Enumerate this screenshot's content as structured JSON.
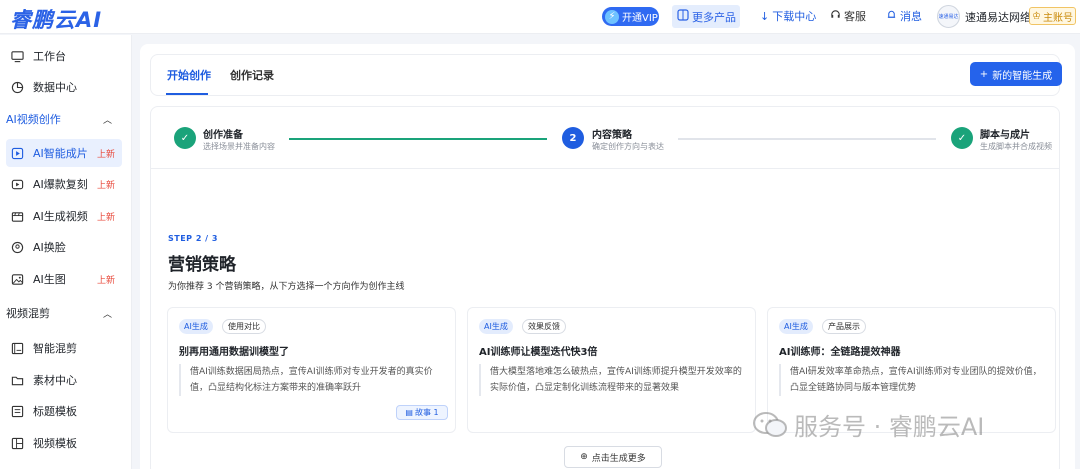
{
  "header": {
    "logo": "睿鹏云AI",
    "vip_label": "开通VIP",
    "more_products": "更多产品",
    "download": "下载中心",
    "service": "客服",
    "messages": "消息",
    "org_name": "速通易达网络",
    "main_account": "主账号",
    "avatar_text": "速通易达"
  },
  "sidebar": {
    "items_top": [
      {
        "label": "工作台",
        "icon": "monitor-icon"
      },
      {
        "label": "数据中心",
        "icon": "pie-chart-icon"
      }
    ],
    "group_ai_video": "AI视频创作",
    "ai_items": [
      {
        "label": "AI智能成片",
        "badge": "上新",
        "icon": "video-play-icon"
      },
      {
        "label": "AI爆款复刻",
        "badge": "上新",
        "icon": "copy-video-icon"
      },
      {
        "label": "AI生成视频",
        "badge": "上新",
        "icon": "generate-video-icon"
      },
      {
        "label": "AI换脸",
        "badge": "",
        "icon": "face-swap-icon"
      },
      {
        "label": "AI生图",
        "badge": "上新",
        "icon": "image-icon"
      }
    ],
    "group_mix": "视频混剪",
    "mix_items": [
      {
        "label": "智能混剪",
        "icon": "smart-mix-icon"
      },
      {
        "label": "素材中心",
        "icon": "folder-icon"
      },
      {
        "label": "标题模板",
        "icon": "title-template-icon"
      },
      {
        "label": "视频模板",
        "icon": "video-template-icon"
      }
    ]
  },
  "tabs": {
    "start": "开始创作",
    "history": "创作记录",
    "new_button": "新的智能生成"
  },
  "steps": [
    {
      "num": "✓",
      "title": "创作准备",
      "sub": "选择场景并准备内容",
      "state": "done"
    },
    {
      "num": "2",
      "title": "内容策略",
      "sub": "确定创作方向与表达",
      "state": "current"
    },
    {
      "num": "✓",
      "title": "脚本与成片",
      "sub": "生成脚本并合成视频",
      "state": "done"
    }
  ],
  "section": {
    "step_label": "STEP 2 / 3",
    "title": "营销策略",
    "desc": "为你推荐 3 个营销策略，从下方选择一个方向作为创作主线"
  },
  "cards": [
    {
      "tag1": "AI生成",
      "tag2": "使用对比",
      "title": "别再用通用数据训模型了",
      "desc": "借AI训练数据困局热点，宣传AI训练师对专业开发者的真实价值，凸显结构化标注方案带来的准确率跃升",
      "badge": "故事 1"
    },
    {
      "tag1": "AI生成",
      "tag2": "效果反馈",
      "title": "AI训练师让模型迭代快3倍",
      "desc": "借大模型落地难怎么破热点，宣传AI训练师提升模型开发效率的实际价值，凸显定制化训练流程带来的显著效果",
      "badge": ""
    },
    {
      "tag1": "AI生成",
      "tag2": "产品展示",
      "title": "AI训练师：全链路提效神器",
      "desc": "借AI研发效率革命热点，宣传AI训练师对专业团队的提效价值，凸显全链路协同与版本管理优势",
      "badge": ""
    }
  ],
  "generate_more": "点击生成更多",
  "watermark": "服务号 · 睿鹏云AI"
}
